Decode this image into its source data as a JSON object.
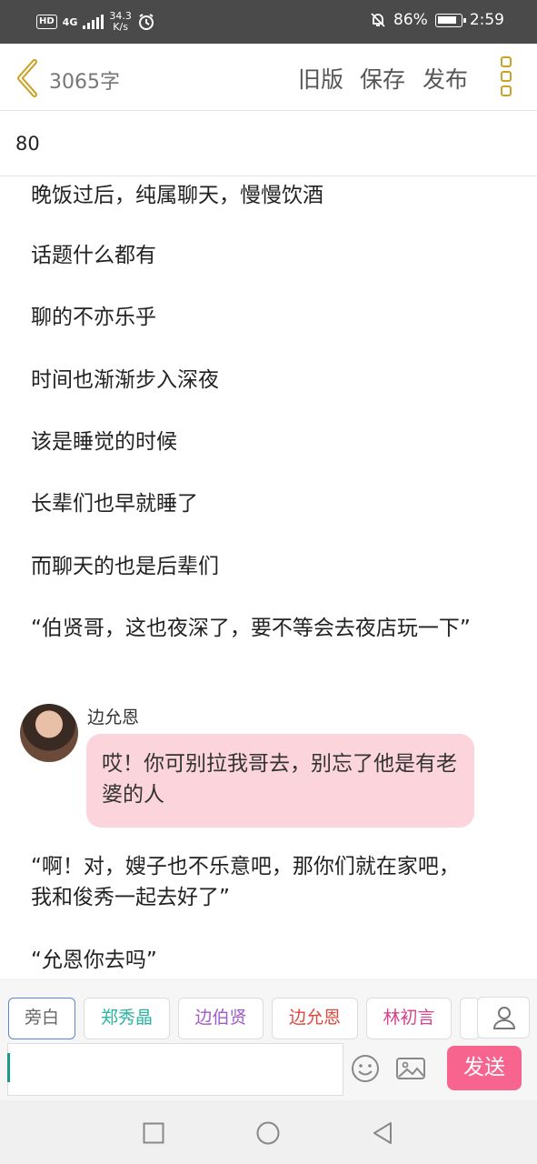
{
  "status_bar": {
    "hd": "HD",
    "network": "4G",
    "speed_value": "34.3",
    "speed_unit": "K/s",
    "battery": "86%",
    "time": "2:59"
  },
  "toolbar": {
    "word_count": "3065字",
    "old_version": "旧版",
    "save": "保存",
    "publish": "发布"
  },
  "chapter_title": "80",
  "paragraphs": [
    "晚饭过后，纯属聊天，慢慢饮酒",
    "话题什么都有",
    "聊的不亦乐乎",
    "时间也渐渐步入深夜",
    "该是睡觉的时候",
    "长辈们也早就睡了",
    "而聊天的也是后辈们",
    "“伯贤哥，这也夜深了，要不等会去夜店玩一下”"
  ],
  "dialogue": {
    "speaker": "边允恩",
    "text": "哎！你可别拉我哥去，别忘了他是有老婆的人"
  },
  "paragraphs_after": [
    "“啊！对，嫂子也不乐意吧，那你们就在家吧，我和俊秀一起去好了”",
    "“允恩你去吗”"
  ],
  "characters": [
    {
      "name": "旁白",
      "color": "#666666"
    },
    {
      "name": "郑秀晶",
      "color": "#2bb3a0"
    },
    {
      "name": "边伯贤",
      "color": "#a05bc9"
    },
    {
      "name": "边允恩",
      "color": "#e0483e"
    },
    {
      "name": "林初言",
      "color": "#d6428a"
    }
  ],
  "input": {
    "value": "",
    "send_label": "发送"
  },
  "colors": {
    "accent_pink": "#f7648e",
    "bubble_pink": "#fcd5dc",
    "menu_gold": "#c9a227"
  }
}
